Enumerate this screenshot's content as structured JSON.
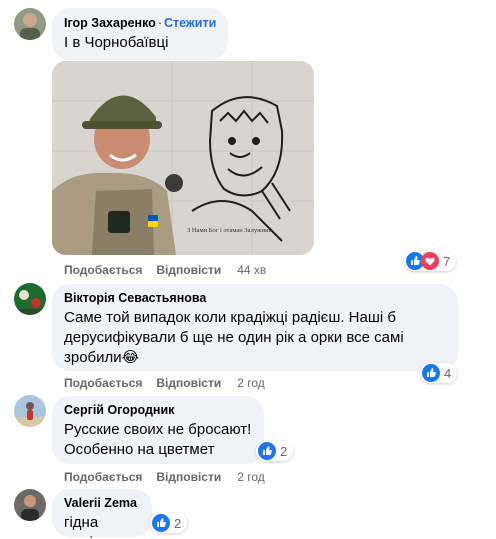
{
  "comments": [
    {
      "author": "Ігор Захаренко",
      "follow_label": "Стежити",
      "text": "І в Чорнобаївці",
      "like_label": "Подобається",
      "reply_label": "Відповісти",
      "time": "44 хв",
      "reaction_count": "7",
      "image_caption": "З Нами Бог і отаман Залужний"
    },
    {
      "author": "Вікторія Севастьянова",
      "text_lines": [
        "Саме той випадок коли крадіжці радієш. Наші б",
        "дерусифікували б ще не один рік а орки все самі",
        "зробили😂"
      ],
      "like_label": "Подобається",
      "reply_label": "Відповісти",
      "time": "2 год",
      "reaction_count": "4"
    },
    {
      "author": "Сергій Огородник",
      "text_lines": [
        "Русские своих не бросают!",
        "Особенно на цветмет"
      ],
      "like_label": "Подобається",
      "reply_label": "Відповісти",
      "time": "2 год",
      "reaction_count": "2"
    },
    {
      "author": "Valerii Zema",
      "text": "гідна заміна",
      "reaction_count": "2"
    }
  ],
  "colors": {
    "link": "#216fdb",
    "bubble": "#f0f2f5",
    "meta": "#65676b",
    "like_blue": "#1877f2",
    "love_red": "#f33e58"
  },
  "icons": [
    "like-reaction-icon",
    "love-reaction-icon"
  ]
}
